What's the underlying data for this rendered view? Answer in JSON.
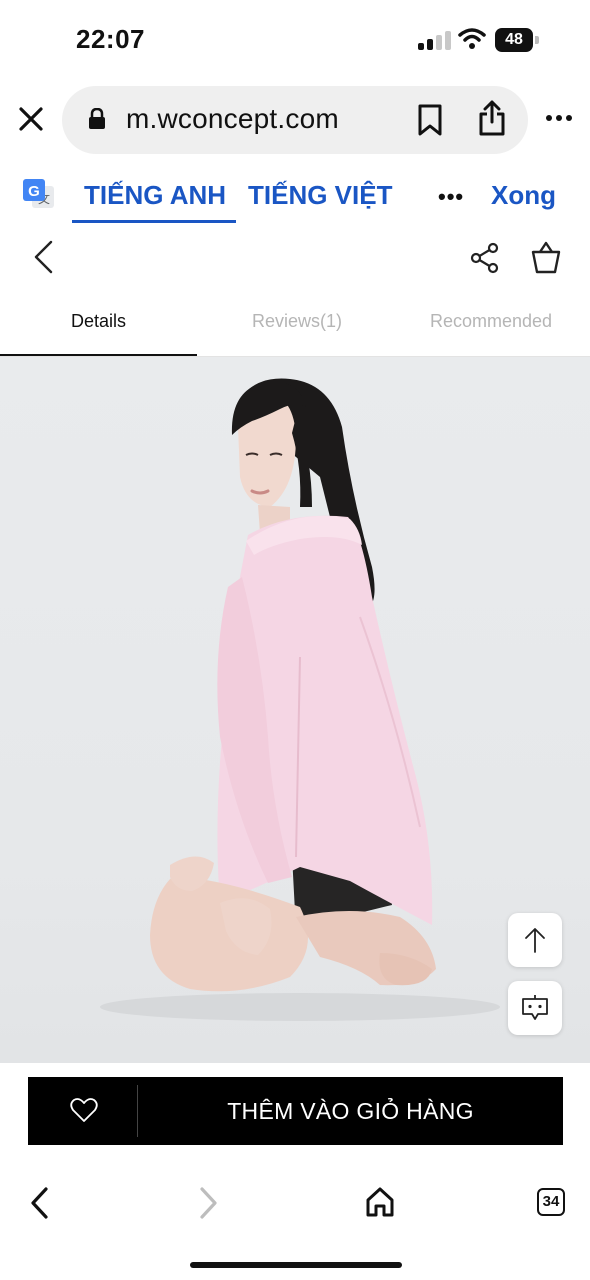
{
  "status_bar": {
    "time": "22:07",
    "battery": "48",
    "icons": [
      "signal-icon",
      "wifi-icon",
      "battery-icon"
    ]
  },
  "browser": {
    "url": "m.wconcept.com",
    "icons": [
      "close-icon",
      "lock-icon",
      "bookmark-icon",
      "share-icon",
      "more-icon"
    ]
  },
  "translate_bar": {
    "source_language": "TIẾNG ANH",
    "target_language": "TIẾNG VIỆT",
    "more": "•••",
    "done": "Xong",
    "accent_color": "#1a56c4"
  },
  "header": {
    "icons": [
      "back-arrow-icon",
      "share-nodes-icon",
      "shopping-bag-icon"
    ]
  },
  "tabs": [
    {
      "label": "Details",
      "active": true
    },
    {
      "label": "Reviews(1)",
      "active": false
    },
    {
      "label": "Recommended",
      "active": false
    }
  ],
  "product": {
    "image": "model-in-pink-oversized-shirt",
    "float_buttons": [
      "scroll-to-top-icon",
      "chat-icon"
    ]
  },
  "cart_bar": {
    "label": "THÊM VÀO GIỎ HÀNG",
    "wishlist_icon": "heart-icon"
  },
  "bottom_toolbar": {
    "tab_count": "34",
    "icons": [
      "back-icon",
      "forward-icon",
      "home-icon",
      "tabs-icon"
    ]
  }
}
